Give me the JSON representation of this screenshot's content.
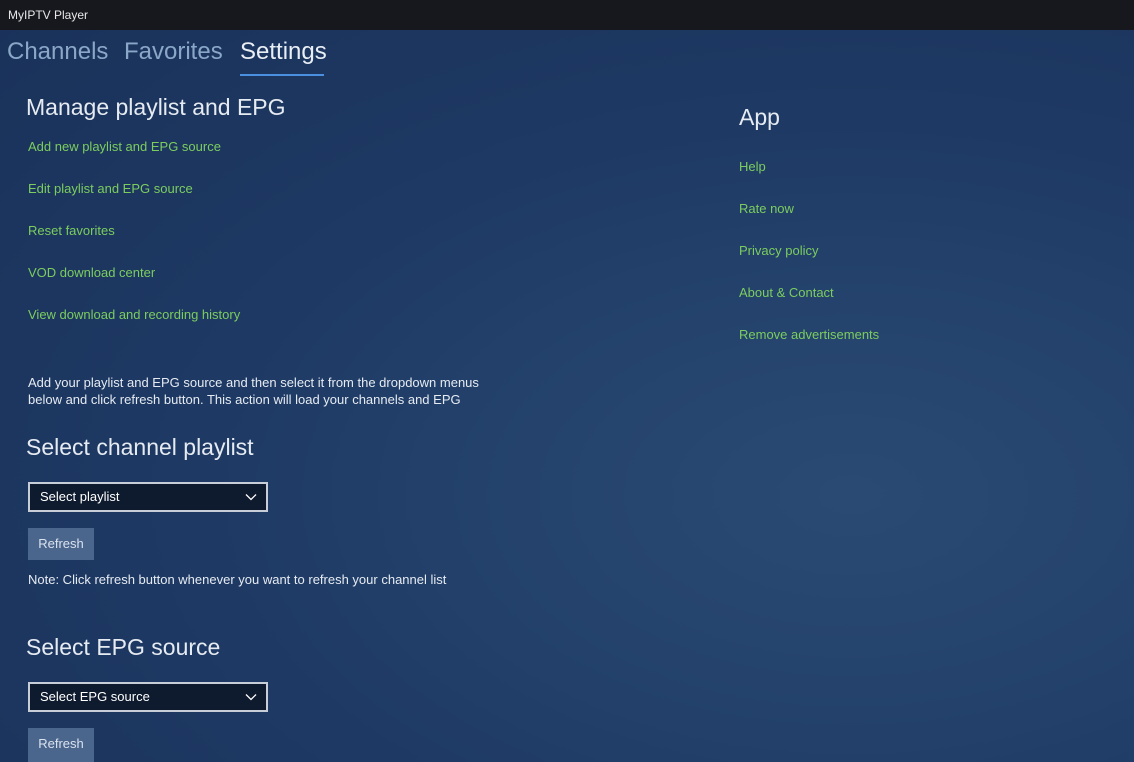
{
  "window": {
    "title": "MyIPTV Player"
  },
  "tabs": [
    {
      "label": "Channels",
      "active": false
    },
    {
      "label": "Favorites",
      "active": false
    },
    {
      "label": "Settings",
      "active": true
    }
  ],
  "manage": {
    "title": "Manage playlist and EPG",
    "links": [
      "Add new playlist and EPG source",
      "Edit playlist and EPG source",
      "Reset favorites",
      "VOD download center",
      "View download and recording history"
    ],
    "info_line1": "Add your playlist and EPG source and then select it from the dropdown menus",
    "info_line2": "below and click refresh button. This action will load your channels and EPG"
  },
  "playlist": {
    "title": "Select channel playlist",
    "dropdown_value": "Select playlist",
    "refresh_label": "Refresh",
    "note": "Note: Click refresh button whenever you want to refresh your channel list"
  },
  "epg": {
    "title": "Select EPG source",
    "dropdown_value": "Select EPG source",
    "refresh_label": "Refresh"
  },
  "app": {
    "title": "App",
    "links": [
      "Help",
      "Rate now",
      "Privacy policy",
      "About & Contact",
      "Remove advertisements"
    ]
  },
  "colors": {
    "link": "#7ccd5f",
    "accent": "#4a8fe0",
    "button": "#4b668d",
    "titlebar": "#16181d"
  },
  "icons": {
    "dropdown_chevron": "chevron-down-icon"
  }
}
